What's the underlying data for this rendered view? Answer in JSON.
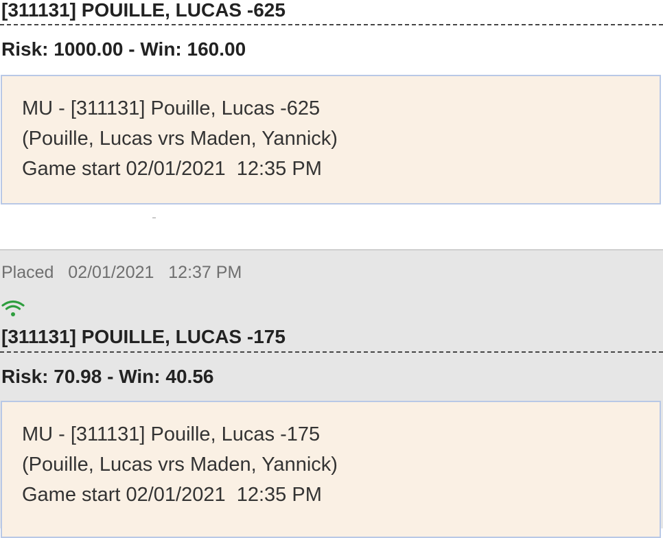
{
  "wagers": [
    {
      "title": "[311131] POUILLE, LUCAS -625",
      "risk_label": "Risk: ",
      "risk_value": "1000.00",
      "win_label": " - Win: ",
      "win_value": "160.00",
      "details": {
        "line1": "MU - [311131] Pouille, Lucas -625",
        "line2": "(Pouille, Lucas vrs Maden, Yannick)",
        "line3": "Game start 02/01/2021  12:35 PM"
      }
    },
    {
      "status": "Placed",
      "placed_date": "02/01/2021",
      "placed_time": "12:37 PM",
      "signal_icon": "wifi-signal-icon",
      "signal_color": "#2e9e3e",
      "title": "[311131] POUILLE, LUCAS -175",
      "risk_label": "Risk: ",
      "risk_value": "70.98",
      "win_label": " - Win: ",
      "win_value": "40.56",
      "details": {
        "line1": "MU - [311131] Pouille, Lucas -175",
        "line2": "(Pouille, Lucas vrs Maden, Yannick)",
        "line3": "Game start 02/01/2021  12:35 PM"
      }
    }
  ],
  "colors": {
    "placed_section_bg": "#e6e6e6",
    "detail_box_bg": "#faf0e4",
    "detail_box_border": "#b8c8e6"
  }
}
